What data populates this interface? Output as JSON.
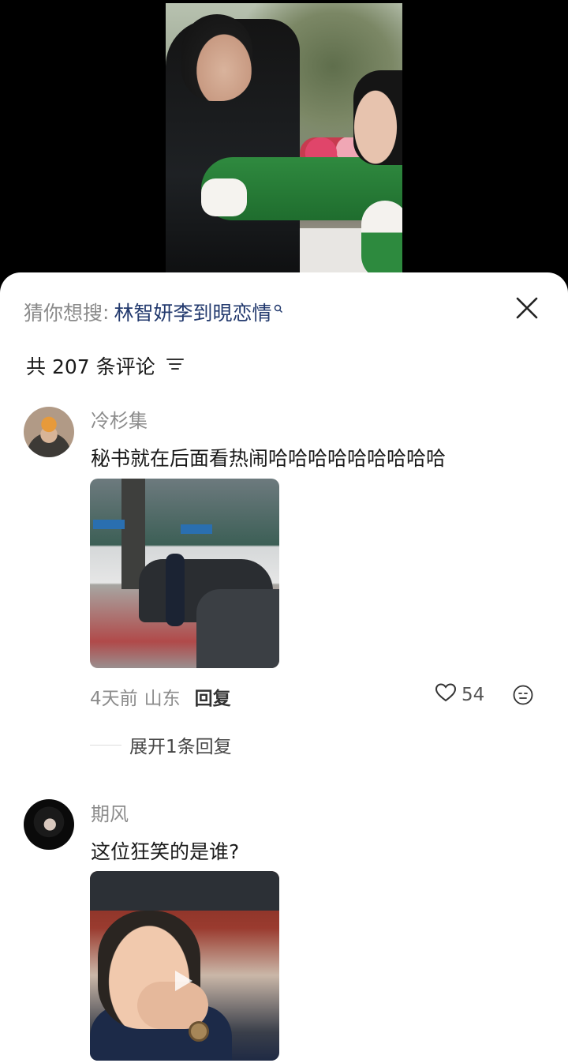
{
  "suggest": {
    "label": "猜你想搜",
    "separator": ":",
    "term": "林智妍李到晛恋情"
  },
  "comments_header": {
    "text": "共 207 条评论"
  },
  "comments": [
    {
      "author": "冷杉集",
      "text": "秘书就在后面看热闹哈哈哈哈哈哈哈哈哈",
      "time": "4天前",
      "location": "山东",
      "reply_label": "回复",
      "likes": "54",
      "expand_label": "展开1条回复"
    },
    {
      "author": "期风",
      "text": "这位狂笑的是谁?"
    }
  ],
  "icons": {
    "search": "search-icon",
    "close": "close-icon",
    "filter": "filter-icon",
    "heart": "heart-icon",
    "emoji": "emoji-icon",
    "play": "play-icon"
  },
  "colors": {
    "suggest_term": "#233a6e",
    "muted": "#8c8c8c"
  }
}
